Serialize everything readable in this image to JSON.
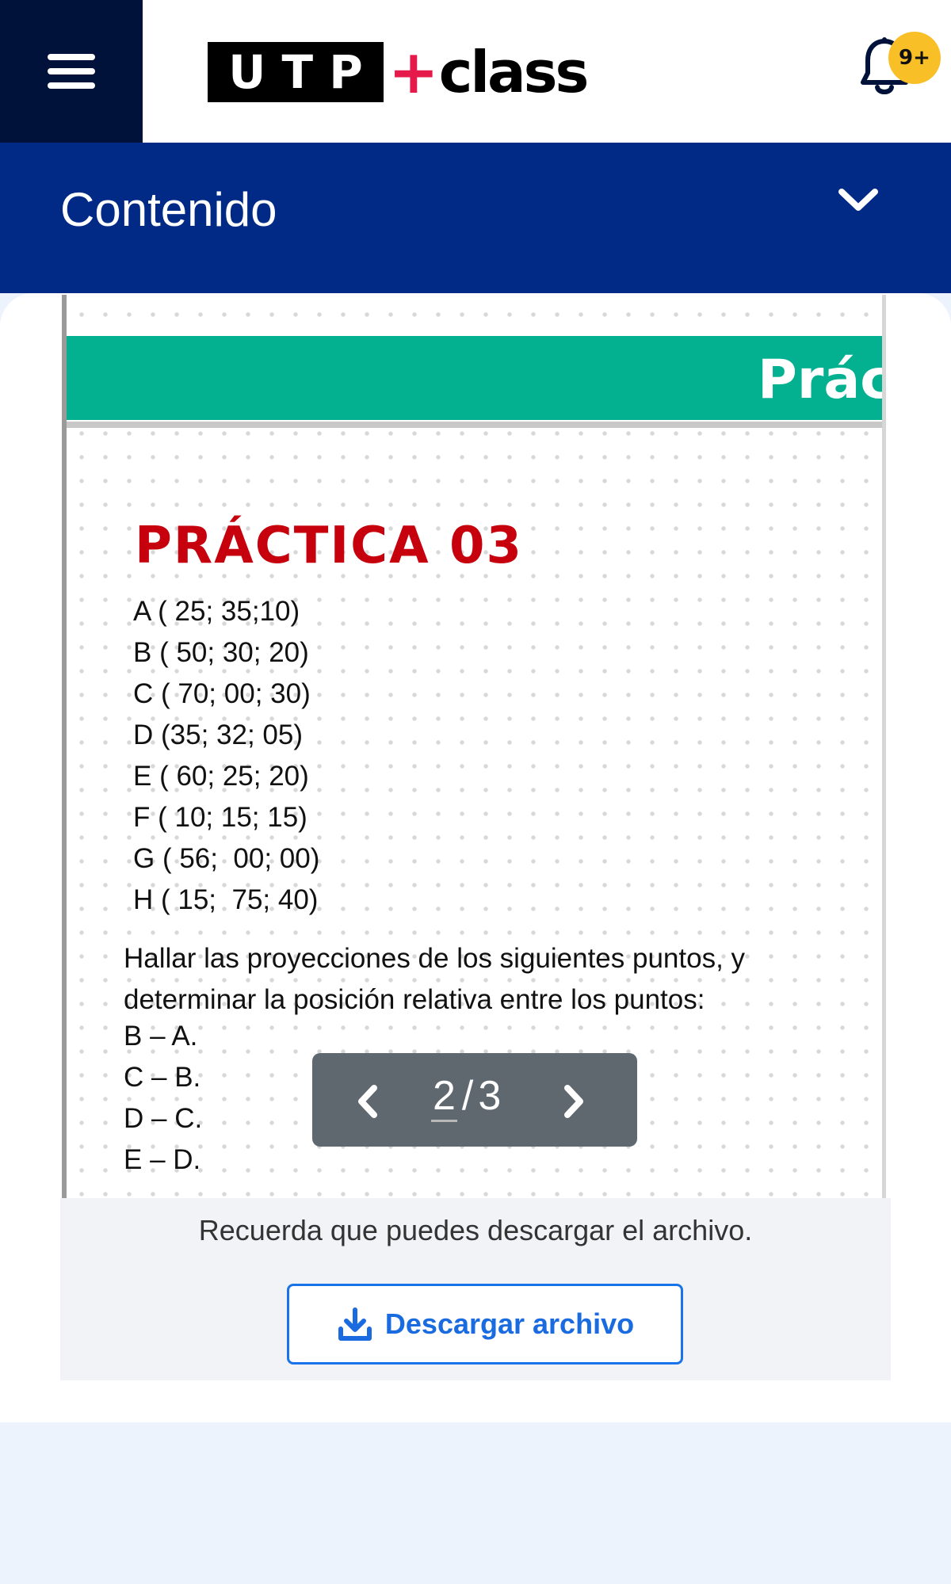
{
  "header": {
    "logo": {
      "utp": "U T P",
      "plus": "+",
      "class": "class"
    },
    "notifications_badge": "9+"
  },
  "content_section": {
    "title": "Contenido"
  },
  "document": {
    "banner_text": "Prác",
    "practice_title": "PRÁCTICA 03",
    "points": [
      "A ( 25; 35;10)",
      "B ( 50; 30; 20)",
      "C ( 70; 00; 30)",
      "D (35; 32; 05)",
      "E ( 60; 25; 20)",
      "F ( 10; 15; 15)",
      "G ( 56;  00; 00)",
      "H ( 15;  75; 40)"
    ],
    "instruction": "Hallar las proyecciones de los siguientes puntos, y determinar la posición relativa entre los puntos:",
    "pairs": [
      "B – A.",
      "C – B.",
      "D – C.",
      "E – D."
    ]
  },
  "pager": {
    "current": "2",
    "separator": "/",
    "total": "3"
  },
  "download": {
    "note": "Recuerda que puedes descargar el archivo.",
    "button_label": "Descargar archivo"
  },
  "colors": {
    "nav_dark": "#01123a",
    "header_blue": "#002a86",
    "banner_green": "#03b090",
    "title_red": "#c6000c",
    "badge_yellow": "#f8bf26",
    "link_blue": "#1a73e8"
  }
}
